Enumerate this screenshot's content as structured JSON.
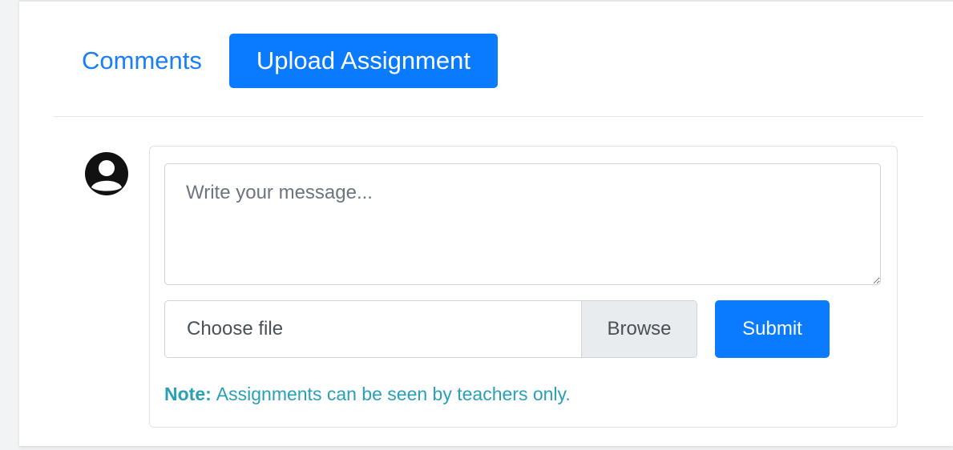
{
  "tabs": {
    "comments_label": "Comments",
    "upload_label": "Upload Assignment"
  },
  "form": {
    "message_placeholder": "Write your message...",
    "file_label": "Choose file",
    "browse_label": "Browse",
    "submit_label": "Submit",
    "note_prefix": "Note:",
    "note_text": "Assignments can be seen by teachers only."
  },
  "icons": {
    "avatar": "user-circle-icon"
  },
  "colors": {
    "primary": "#0a7bff",
    "link": "#1a7ef7",
    "note": "#2a9fb8"
  }
}
